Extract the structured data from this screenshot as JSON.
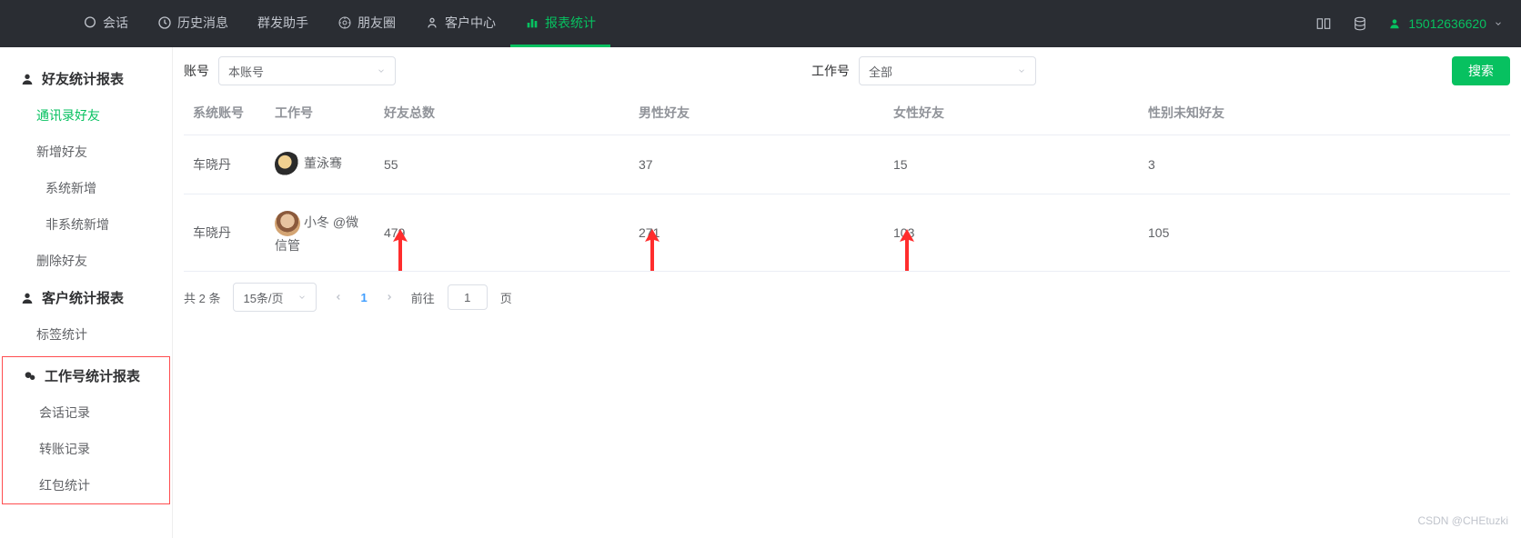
{
  "colors": {
    "accent": "#07c160",
    "danger": "#ff4d4f"
  },
  "topnav": {
    "items": [
      {
        "label": "会话"
      },
      {
        "label": "历史消息"
      },
      {
        "label": "群发助手"
      },
      {
        "label": "朋友圈"
      },
      {
        "label": "客户中心"
      },
      {
        "label": "报表统计"
      }
    ]
  },
  "user": {
    "phone": "15012636620"
  },
  "sidebar": {
    "g1": {
      "title": "好友统计报表",
      "items": [
        "通讯录好友",
        "新增好友",
        "系统新增",
        "非系统新增",
        "删除好友"
      ]
    },
    "g2": {
      "title": "客户统计报表",
      "items": [
        "标签统计"
      ]
    },
    "g3": {
      "title": "工作号统计报表",
      "items": [
        "会话记录",
        "转账记录",
        "红包统计"
      ]
    }
  },
  "filter": {
    "label_account": "账号",
    "select_account": "本账号",
    "label_work": "工作号",
    "select_work": "全部",
    "search": "搜索"
  },
  "table": {
    "headers": [
      "系统账号",
      "工作号",
      "好友总数",
      "男性好友",
      "女性好友",
      "性别未知好友"
    ],
    "rows": [
      {
        "account": "车晓丹",
        "work_name": "董泳骞",
        "total": "55",
        "male": "37",
        "female": "15",
        "unknown": "3"
      },
      {
        "account": "车晓丹",
        "work_name": "小冬 @微信管",
        "total": "479",
        "male": "271",
        "female": "103",
        "unknown": "105"
      }
    ]
  },
  "pagination": {
    "total_text": "共 2 条",
    "per_page": "15条/页",
    "current": "1",
    "goto_prefix": "前往",
    "goto_value": "1",
    "goto_suffix": "页"
  },
  "watermark": "CSDN @CHEtuzki"
}
